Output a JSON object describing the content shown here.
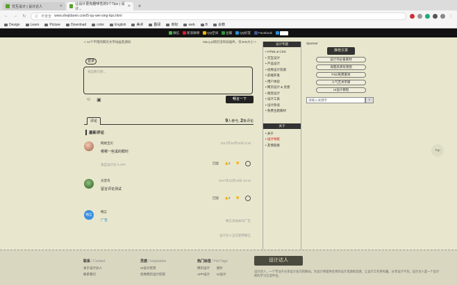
{
  "browser": {
    "tabs": [
      {
        "title": "交互设计 | 设计达人"
      },
      {
        "title": "让设计更有趣味性的5个Tips | 设计..."
      }
    ],
    "insecure_label": "不安全",
    "url": "www.shejidaren.com/5-qu-wei-sing-tips.html",
    "bookmarks": [
      "Design",
      "Learn",
      "Picture",
      "Download",
      "color",
      "English",
      "美术",
      "翻译",
      "商标",
      "web",
      "B",
      "会籍"
    ]
  },
  "sitebar": {
    "shares": [
      {
        "label": "微信",
        "color": "#44b549"
      },
      {
        "label": "新浪微博",
        "color": "#e6162d"
      },
      {
        "label": "QQ空间",
        "color": "#f7b500"
      },
      {
        "label": "豆瓣",
        "color": "#2f963a"
      },
      {
        "label": "QQ好友",
        "color": "#2d8cd8"
      },
      {
        "label": "Facebook",
        "color": "#3b5998"
      }
    ]
  },
  "article": {
    "prev": "< 14个不错的网页文字动画及源码",
    "next": "Macy.js网页流布局插件，仅4KB大小 >"
  },
  "comment_form": {
    "login_label": "登录",
    "placeholder": "来说两句吧...",
    "send_label": "畅言一下"
  },
  "comments_section": {
    "tab_label": "评论",
    "participants": "9",
    "participants_label": "人参与,",
    "comments": "2",
    "comments_label": "条评论",
    "latest_title": "最新评论",
    "items": [
      {
        "name": "网易宝贝",
        "time": "2017年10月18日 8:18",
        "text": "哪哪一些溪的概时",
        "sub": "来自设计达人APP",
        "reply": "回复",
        "likes": "2"
      },
      {
        "name": "天堂鸟",
        "time": "2017年10月18日 18:13",
        "text": "留言评论测试",
        "reply": "回复",
        "likes": "2"
      },
      {
        "name": "畅言",
        "text": "广告",
        "ad_avatar_label": "畅言"
      }
    ],
    "ad_note_1": "畅言添加本页广告",
    "ad_note_2": "设计达人正在使用畅言"
  },
  "nav": {
    "head1": "设计专题",
    "items1": [
      "HTML & CSS",
      "交互设计",
      "产品设计",
      "优秀设计资源",
      "前端开发",
      "用户体验",
      "网页设计 & 灵感",
      "视觉设计",
      "设计工具",
      "设计杂谈",
      "免费主题素材"
    ],
    "head2": "关于",
    "items2": [
      "关于",
      "设计导航",
      "友情链接"
    ]
  },
  "sidebar": {
    "sponsor_label": "Sponsor",
    "rec_head": "推荐文章",
    "rec_items": [
      "设计师必备素材",
      "海量高清背景图",
      "PSD免费素材",
      "人气艺术字库",
      "UI设计教程"
    ],
    "search_placeholder": "请输入关键字"
  },
  "top_label": "Top",
  "footer": {
    "col1_head": "联系",
    "col1_sub": "/ Contact",
    "col1_rows": [
      [
        "关于设计达人"
      ],
      [
        "联系我们"
      ]
    ],
    "col2_head": "灵感",
    "col2_sub": "/ Inspiration",
    "col2_rows": [
      [
        "UI设计欣赏"
      ],
      [
        "优秀网页设计欣赏"
      ]
    ],
    "col3_head": "热门标签",
    "col3_sub": "/ Hot Tags",
    "col3_rows": [
      [
        "网页设计",
        "图片"
      ],
      [
        "APP设计",
        "UI设计"
      ]
    ],
    "logo_text": "设计达人",
    "about_text": "设计达人，一个专注于分享设计技巧的网站，为设计师提供优秀的设计资源和灵感，让设计工作更有趣。分享设计干货，设计达人是一个设计师的学习交流平台。"
  }
}
